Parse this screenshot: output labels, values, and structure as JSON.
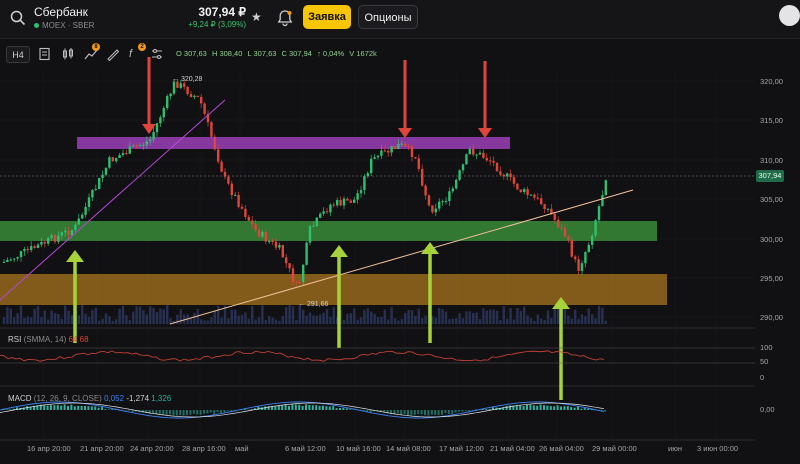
{
  "header": {
    "ticker_name": "Сбербанк",
    "exchange": "MOEX · SBER",
    "price": "307,94 ₽",
    "change": "+9,24 ₽ (3,09%)",
    "order_button": "Заявка",
    "options_button": "Опционы"
  },
  "toolbar": {
    "timeframe": "H4",
    "drawing_badge": "8",
    "indicator_badge": "2",
    "ohlc": {
      "o": "O 307,63",
      "h": "H 308,40",
      "l": "L 307,63",
      "c": "C 307,94",
      "chg": "↑ 0,04%",
      "vol": "V 1672k"
    }
  },
  "chart": {
    "current_price_tag": "307,94",
    "high_label": "320,28",
    "low_label": "291,66",
    "y_axis_labels": [
      "320,00",
      "315,00",
      "310,00",
      "305,00",
      "300,00",
      "295,00",
      "290,00"
    ],
    "rsi_axis_labels": [
      "100",
      "50",
      "0"
    ],
    "macd_axis_label": "0,00",
    "x_axis_labels": [
      "16 апр 20:00",
      "21 апр 20:00",
      "24 апр 20:00",
      "28 апр 16:00",
      "май",
      "6 май 12:00",
      "10 май 16:00",
      "14 май 08:00",
      "17 май 12:00",
      "21 май 04:00",
      "26 май 04:00",
      "29 май 00:00",
      "июн",
      "3 июн 00:00"
    ]
  },
  "rsi": {
    "name": "RSI",
    "params": "(SMMA, 14)",
    "v1": "64",
    "v2": "68"
  },
  "macd": {
    "name": "MACD",
    "params": "(12, 26, 9, CLOSE)",
    "v1": "0,052",
    "v2": "-1,274",
    "v3": "1,326"
  },
  "colors": {
    "up": "#2fbf71",
    "down": "#e0453a",
    "accent": "#f7c600",
    "resistance_zone": "#9b3fb8",
    "support_zone": "#3d9a3d",
    "demand_zone": "#a8741e"
  },
  "icons": [
    "search-icon",
    "star-icon",
    "bell-icon",
    "avatar-icon",
    "chart-type-icon",
    "candles-icon",
    "indicators-icon",
    "drawing-icon",
    "formula-icon",
    "compare-icon"
  ]
}
